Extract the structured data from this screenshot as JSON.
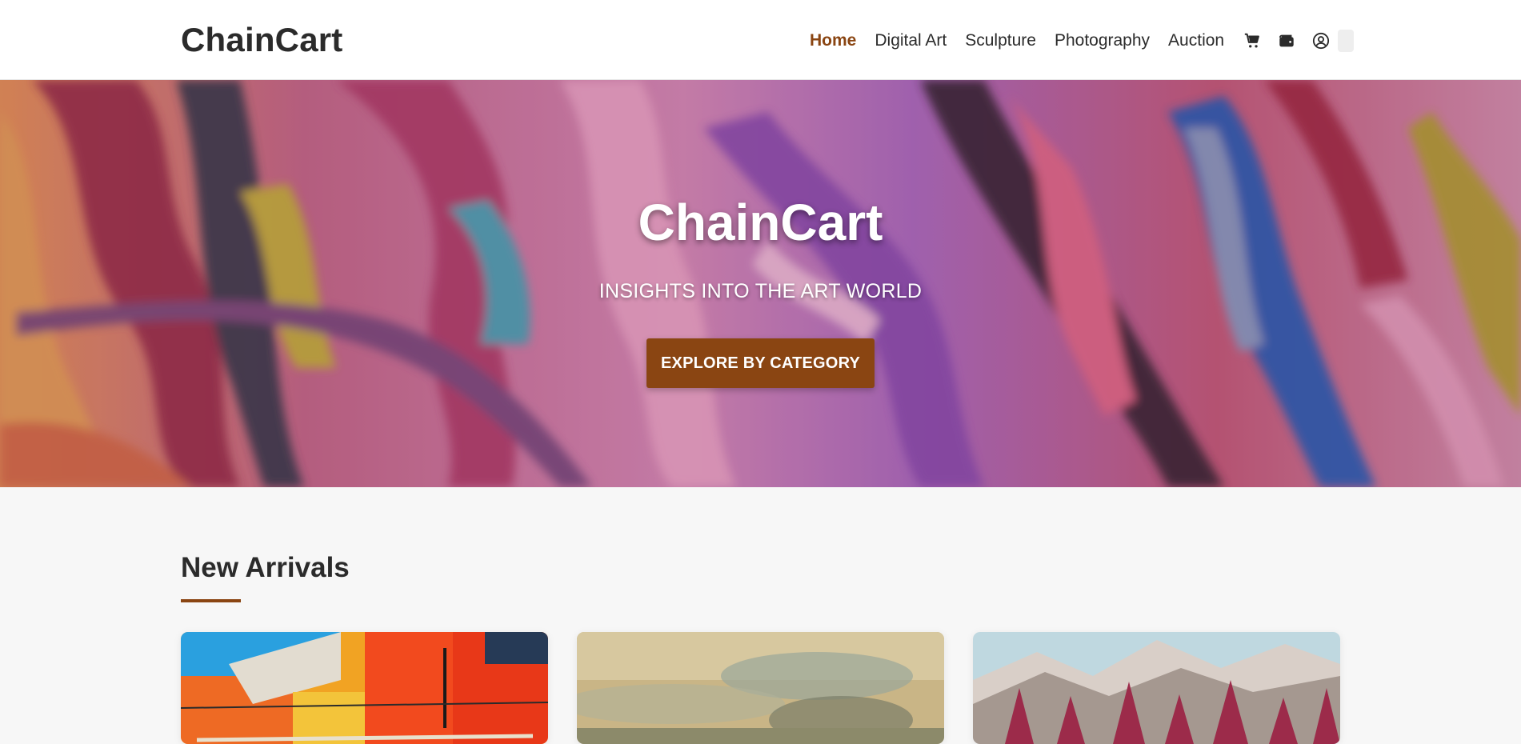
{
  "header": {
    "logo": "ChainCart",
    "nav": [
      {
        "label": "Home",
        "active": true
      },
      {
        "label": "Digital Art",
        "active": false
      },
      {
        "label": "Sculpture",
        "active": false
      },
      {
        "label": "Photography",
        "active": false
      },
      {
        "label": "Auction",
        "active": false
      }
    ],
    "icons": [
      "cart-icon",
      "wallet-icon",
      "user-circle-icon"
    ]
  },
  "hero": {
    "title": "ChainCart",
    "subtitle": "INSIGHTS INTO THE ART WORLD",
    "cta_label": "EXPLORE BY CATEGORY"
  },
  "new_arrivals": {
    "title": "New Arrivals",
    "cards": [
      {
        "image": "abstract-red-orange-painting"
      },
      {
        "image": "landscape-oil-painting"
      },
      {
        "image": "snowy-mountains-pink-trees-painting"
      }
    ]
  },
  "colors": {
    "accent": "#8a4512",
    "text": "#2b2b2b",
    "background": "#f7f7f7",
    "header_bg": "#ffffff"
  }
}
